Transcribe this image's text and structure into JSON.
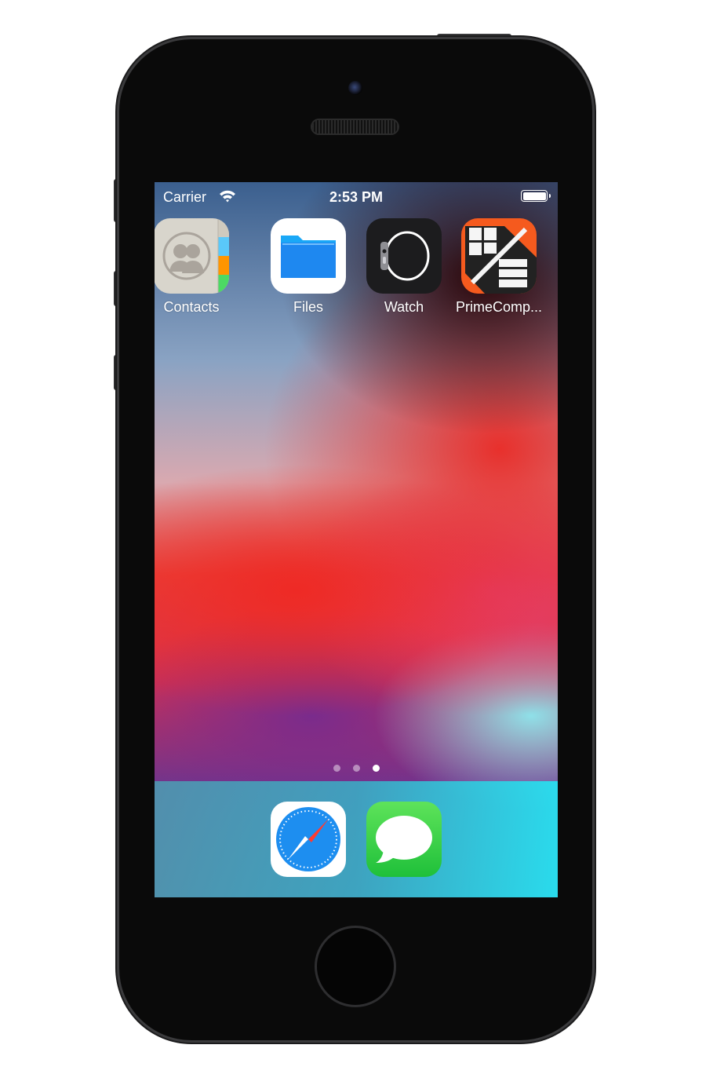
{
  "status_bar": {
    "carrier": "Carrier",
    "time": "2:53 PM",
    "battery_level": 1.0,
    "wifi_icon": "wifi-icon"
  },
  "apps": [
    {
      "label": "Contacts",
      "icon": "contacts-icon"
    },
    {
      "label": "Files",
      "icon": "files-folder-icon"
    },
    {
      "label": "Watch",
      "icon": "apple-watch-icon"
    },
    {
      "label": "PrimeComp...",
      "icon": "primecomp-icon"
    }
  ],
  "page_indicator": {
    "pages": 3,
    "current": 3
  },
  "dock": [
    {
      "icon": "safari-compass-icon"
    },
    {
      "icon": "messages-bubble-icon"
    }
  ],
  "colors": {
    "files_blue": "#1e90f5",
    "messages_green": "#35c94a",
    "primecomp_orange": "#f55a1e"
  }
}
